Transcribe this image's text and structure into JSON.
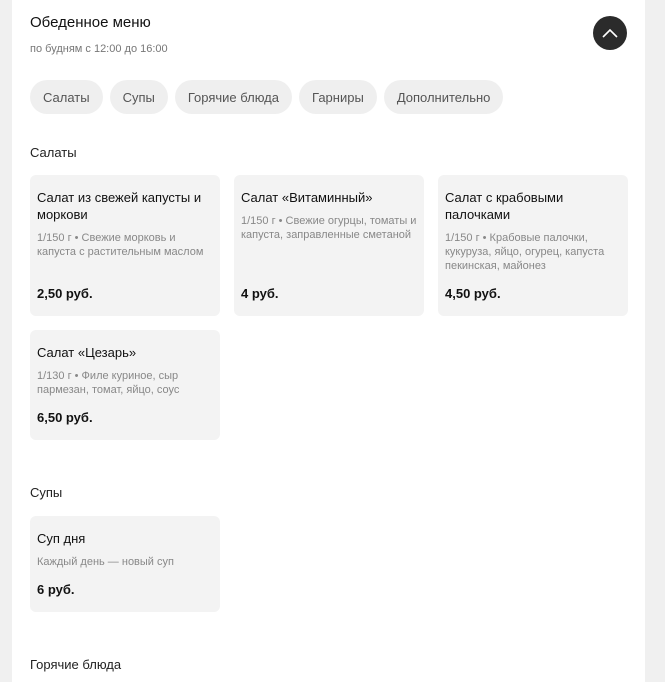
{
  "header": {
    "title": "Обеденное меню",
    "schedule": "по будням с 12:00 до 16:00"
  },
  "icons": {
    "collapse": "chevron-up-icon"
  },
  "tabs": [
    "Салаты",
    "Супы",
    "Горячие блюда",
    "Гарниры",
    "Дополнительно"
  ],
  "sections": {
    "salads": {
      "title": "Салаты",
      "items": [
        {
          "name": "Салат из свежей капусты и моркови",
          "desc": "1/150 г • Свежие морковь и капуста с растительным маслом",
          "price": "2,50 руб."
        },
        {
          "name": "Салат «Витаминный»",
          "desc": "1/150 г • Свежие огурцы, томаты и капуста, заправленные сметаной",
          "price": "4 руб."
        },
        {
          "name": "Салат с крабовыми палочками",
          "desc": "1/150 г • Крабовые палочки, кукуруза, яйцо, огурец, капуста пекинская, майонез",
          "price": "4,50 руб."
        },
        {
          "name": "Салат «Цезарь»",
          "desc": "1/130 г • Филе куриное, сыр пармезан, томат, яйцо, соус",
          "price": "6,50 руб."
        }
      ]
    },
    "soups": {
      "title": "Супы",
      "items": [
        {
          "name": "Суп дня",
          "desc": "Каждый день — новый суп",
          "price": "6 руб."
        }
      ]
    },
    "hot": {
      "title": "Горячие блюда"
    }
  },
  "colors": {
    "card_bg": "#f3f3f3",
    "chip_bg": "#efefef",
    "button_dark": "#2b2b2b"
  }
}
